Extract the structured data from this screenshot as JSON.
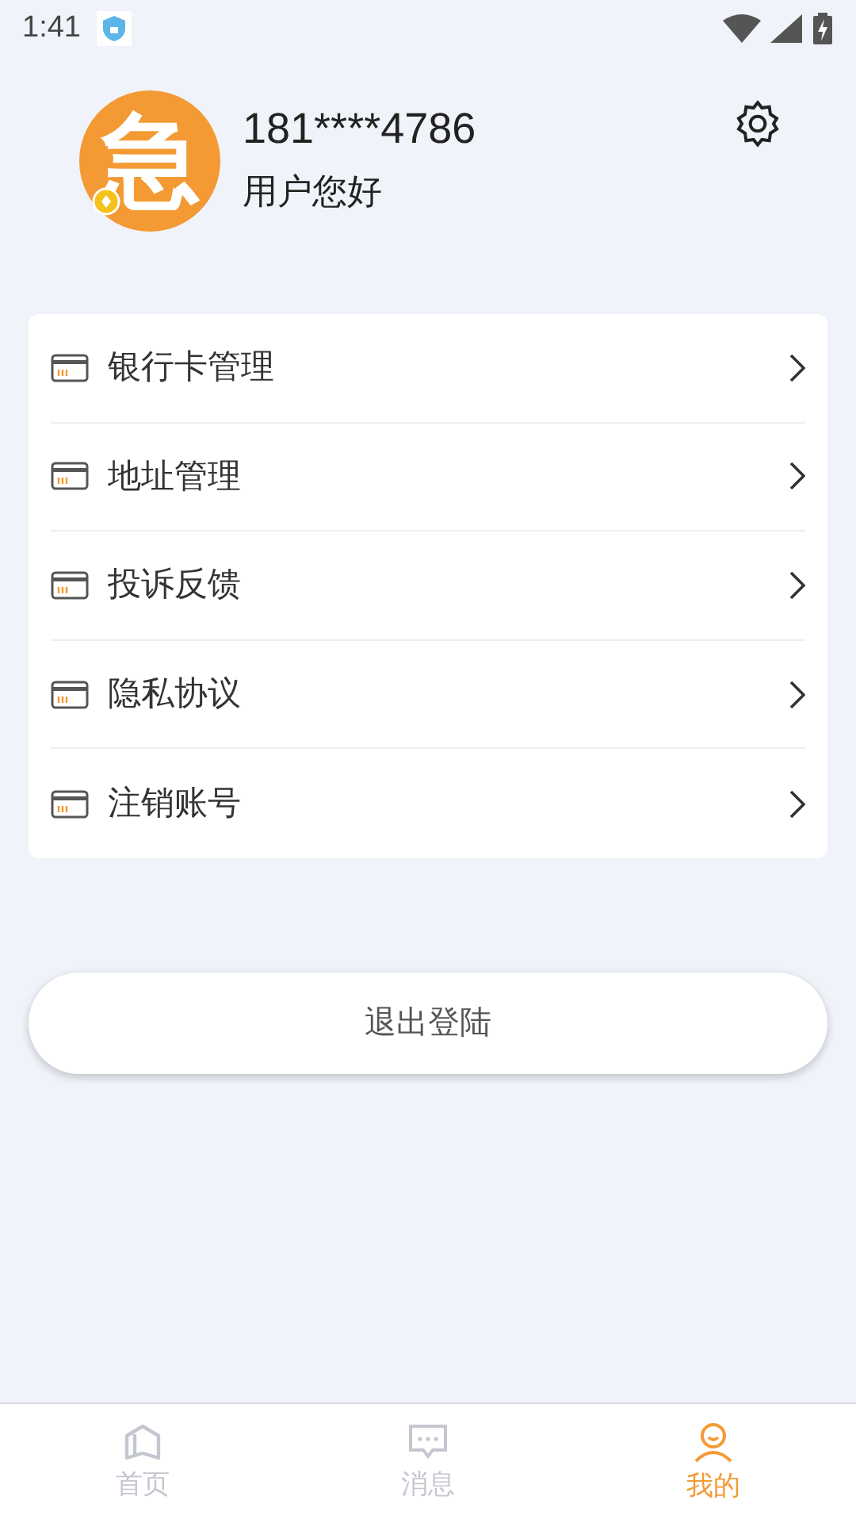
{
  "status_bar": {
    "time": "1:41"
  },
  "profile": {
    "avatar_text": "急",
    "phone": "181****4786",
    "greeting": "用户您好"
  },
  "menu": [
    {
      "label": "银行卡管理"
    },
    {
      "label": "地址管理"
    },
    {
      "label": "投诉反馈"
    },
    {
      "label": "隐私协议"
    },
    {
      "label": "注销账号"
    }
  ],
  "logout_button": "退出登陆",
  "tab_bar": [
    {
      "kind": "home",
      "label": "首页",
      "selected": false
    },
    {
      "kind": "message",
      "label": "消息",
      "selected": false
    },
    {
      "kind": "user",
      "label": "我的",
      "selected": true
    }
  ]
}
